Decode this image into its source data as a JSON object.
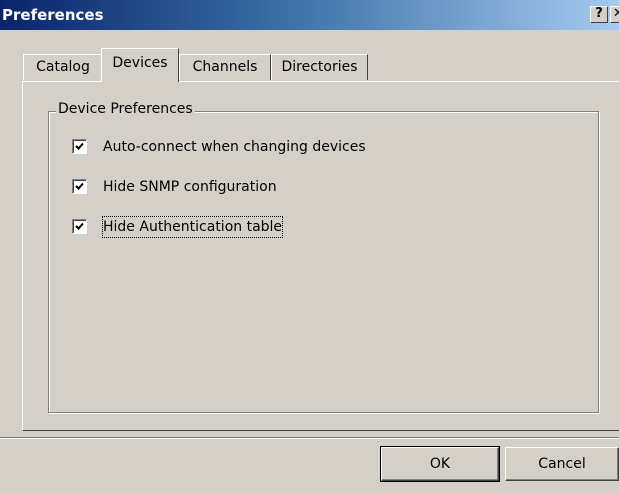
{
  "window": {
    "title": "Preferences",
    "help_label": "?",
    "close_label": "✕"
  },
  "tabs": [
    {
      "label": "Catalog",
      "active": false
    },
    {
      "label": "Devices",
      "active": true
    },
    {
      "label": "Channels",
      "active": false
    },
    {
      "label": "Directories",
      "active": false
    }
  ],
  "device_preferences": {
    "legend": "Device Preferences",
    "options": [
      {
        "label": "Auto-connect when changing devices",
        "checked": true
      },
      {
        "label": "Hide SNMP configuration",
        "checked": true
      },
      {
        "label": "Hide Authentication table",
        "checked": true,
        "focused": true
      }
    ]
  },
  "buttons": {
    "ok": "OK",
    "cancel": "Cancel"
  },
  "colors": {
    "title_start": "#0a246a",
    "title_end": "#a6caf0",
    "face": "#d4d0c8"
  }
}
